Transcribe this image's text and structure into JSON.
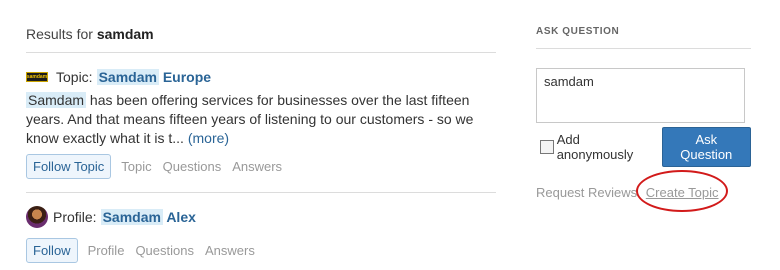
{
  "results": {
    "prefix": "Results for",
    "query": "samdam"
  },
  "items": [
    {
      "kind": "Topic:",
      "name_highlight": "Samdam",
      "name_rest": "Europe",
      "logo_text": "samdam",
      "desc_highlight": "Samdam",
      "desc_rest": "has been offering services for businesses over the last fifteen  years. And that means fifteen years of listening to our customers - so  we know exactly what it is t...",
      "more": "(more)",
      "follow_label": "Follow Topic",
      "links": [
        "Topic",
        "Questions",
        "Answers"
      ]
    },
    {
      "kind": "Profile:",
      "name_highlight": "Samdam",
      "name_rest": "Alex",
      "follow_label": "Follow",
      "links": [
        "Profile",
        "Questions",
        "Answers"
      ]
    }
  ],
  "sidebar": {
    "title": "ASK QUESTION",
    "question_value": "samdam",
    "anonymous_label": "Add anonymously",
    "ask_button": "Ask Question",
    "request_reviews": "Request Reviews",
    "create_topic": "Create Topic"
  },
  "colors": {
    "link": "#2a6496",
    "primary_button": "#3478b9",
    "annotation": "#d21a1a"
  }
}
